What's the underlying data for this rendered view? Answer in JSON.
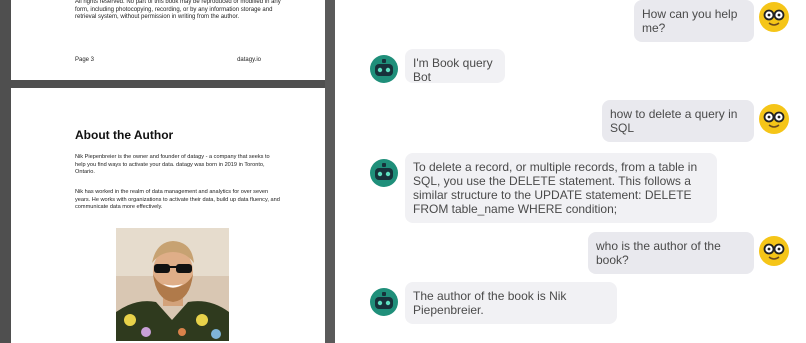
{
  "document": {
    "page_top": {
      "rights_text": "All rights reserved. No part of this book may be reproduced or modified in any form, including photocopying, recording, or by any information storage and retrieval system, without permission in writing from the author.",
      "page_label": "Page 3",
      "footer_site": "datagy.io"
    },
    "page_about": {
      "heading": "About the Author",
      "paragraph1": "Nik Piepenbreier is the owner and founder of datagy - a company that seeks to help you find ways to activate your data. datagy was born in 2019 in Toronto, Ontario.",
      "paragraph2": "Nik has worked in the realm of data management and analytics for over seven years. He works with organizations to activate their data, build up data fluency, and communicate data more effectively."
    }
  },
  "chat": {
    "messages": [
      {
        "role": "user",
        "text": "How can you help me?"
      },
      {
        "role": "bot",
        "text": "I'm Book query Bot"
      },
      {
        "role": "user",
        "text": "how to delete a query in SQL"
      },
      {
        "role": "bot",
        "text": "To delete a record, or multiple records, from a table in SQL, you use the DELETE statement. This follows a similar structure to the UPDATE statement: DELETE FROM table_name WHERE condition;"
      },
      {
        "role": "user",
        "text": "who is the author of the book?"
      },
      {
        "role": "bot",
        "text": "The author of the book is Nik Piepenbreier."
      }
    ]
  },
  "colors": {
    "viewer_background": "#4f4f4f",
    "user_bubble": "#e9e9ee",
    "bot_bubble": "#f1f1f4",
    "user_avatar": "#f5c518",
    "bot_avatar": "#1f8f7a"
  },
  "icons": {
    "user_avatar": "smiley-glasses-icon",
    "bot_avatar": "robot-icon"
  }
}
